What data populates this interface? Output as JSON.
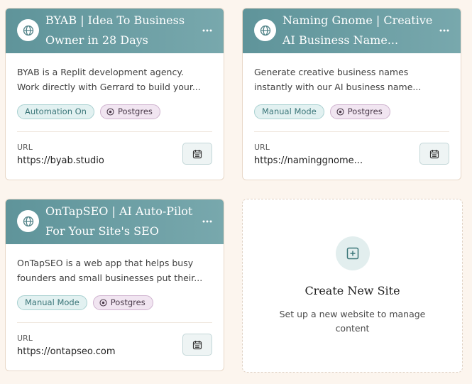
{
  "sites": [
    {
      "title_line1": "BYAB | Idea To Business",
      "title_line2": "Owner in 28 Days",
      "desc_line1": "BYAB is a Replit development agency.",
      "desc_line2": "Work directly with Gerrard to build your...",
      "mode_tag": "Automation On",
      "db_tag": "Postgres",
      "url_label": "URL",
      "url": "https://byab.studio"
    },
    {
      "title_line1": "Naming Gnome | Creative",
      "title_line2": "AI Business Name...",
      "desc_line1": "Generate creative business names",
      "desc_line2": "instantly with our AI business name...",
      "mode_tag": "Manual Mode",
      "db_tag": "Postgres",
      "url_label": "URL",
      "url": "https://naminggnome..."
    },
    {
      "title_line1": "OnTapSEO | AI Auto-Pilot",
      "title_line2": "For Your Site's SEO",
      "desc_line1": "OnTapSEO is a web app that helps busy",
      "desc_line2": "founders and small businesses put their...",
      "mode_tag": "Manual Mode",
      "db_tag": "Postgres",
      "url_label": "URL",
      "url": "https://ontapseo.com"
    }
  ],
  "create_card": {
    "title": "Create New Site",
    "subtitle": "Set up a new website to manage content"
  },
  "icons": {
    "site_badge": "globe-icon",
    "more": "more-horizontal-icon",
    "db_tag": "circle-dot-icon",
    "schedule": "calendar-icon",
    "create": "plus-square-icon"
  },
  "colors": {
    "background": "#fcf5ee",
    "header_teal": "#5f949a",
    "accent_teal": "#3b7679",
    "db_tag_purple": "#f1e5f1"
  }
}
